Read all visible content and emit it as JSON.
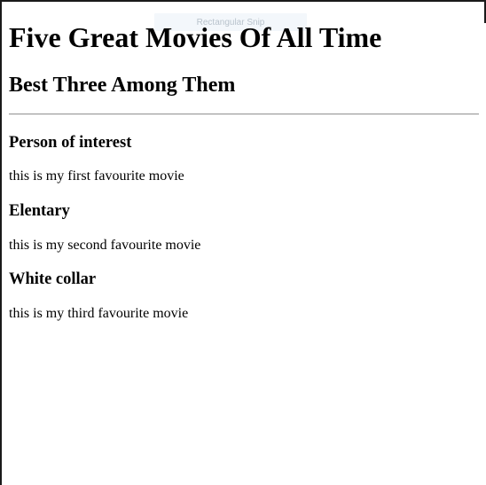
{
  "overlay": {
    "label": "Rectangular Snip"
  },
  "page": {
    "heading": "Five Great Movies Of All Time",
    "subheading": "Best Three Among Them"
  },
  "movies": [
    {
      "title": "Person of interest",
      "description": "this is my first favourite movie"
    },
    {
      "title": "Elentary",
      "description": "this is my second favourite movie"
    },
    {
      "title": "White collar",
      "description": "this is my third favourite movie"
    }
  ]
}
